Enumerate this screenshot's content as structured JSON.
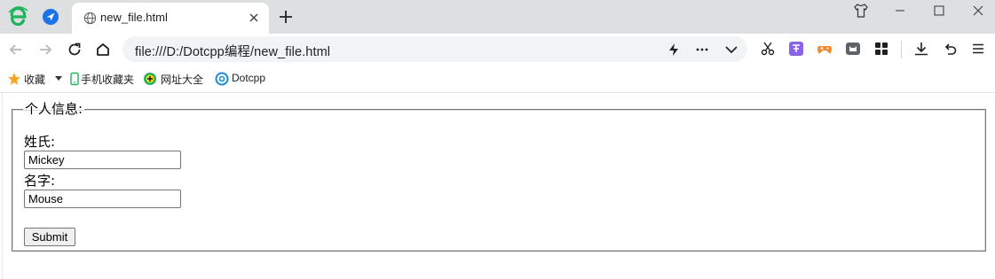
{
  "tab": {
    "title": "new_file.html"
  },
  "address_bar": {
    "url": "file:///D:/Dotcpp编程/new_file.html"
  },
  "bookmarks": [
    {
      "label": "收藏",
      "icon": "star-icon"
    },
    {
      "label": "手机收藏夹",
      "icon": "phone-icon"
    },
    {
      "label": "网址大全",
      "icon": "site-directory-icon"
    },
    {
      "label": "Dotcpp",
      "icon": "dotcpp-logo-icon"
    }
  ],
  "form": {
    "legend": "个人信息:",
    "first_name_label": "姓氏:",
    "first_name_value": "Mickey",
    "last_name_label": "名字:",
    "last_name_value": "Mouse",
    "submit_label": "Submit"
  },
  "colors": {
    "tabbar_bg": "#dedfe1",
    "accent_green": "#1fb45c",
    "accent_blue": "#1a73e8"
  }
}
